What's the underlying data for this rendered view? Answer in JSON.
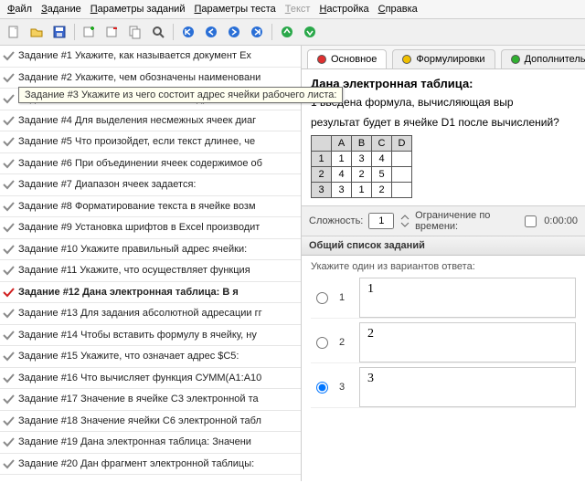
{
  "menu": [
    "Файл",
    "Задание",
    "Параметры заданий",
    "Параметры теста",
    "Текст",
    "Настройка",
    "Справка"
  ],
  "menu_disabled_index": 4,
  "tasks": [
    {
      "label": "Задание #1 Укажите, как называется документ Ex"
    },
    {
      "label": "Задание #2 Укажите, чем обозначены наименовани"
    },
    {
      "label": "Задание #3 Укажите из чего состоит адрес ячейк"
    },
    {
      "label": "Задание #4 Для выделения несмежных ячеек диаг"
    },
    {
      "label": "Задание #5 Что произойдет, если текст длинее, че"
    },
    {
      "label": "Задание #6 При объединении ячеек содержимое об"
    },
    {
      "label": "Задание #7 Диапазон ячеек задается:"
    },
    {
      "label": "Задание #8 Форматирование текста в ячейке возм"
    },
    {
      "label": "Задание #9 Установка шрифтов в Excel производит"
    },
    {
      "label": "Задание #10 Укажите правильный адрес ячейки:"
    },
    {
      "label": "Задание #11 Укажите, что осуществляет функция"
    },
    {
      "label": "Задание #12 Дана электронная таблица:  В я",
      "selected": true
    },
    {
      "label": "Задание #13 Для задания абсолютной адресации гг"
    },
    {
      "label": "Задание #14 Чтобы вставить формулу в ячейку, ну"
    },
    {
      "label": "Задание #15 Укажите, что означает адрес $C5:"
    },
    {
      "label": "Задание #16 Что вычисляет функция СУММ(A1:A10"
    },
    {
      "label": "Задание #17 Значение в ячейке C3 электронной та"
    },
    {
      "label": "Задание #18 Значение ячейки C6 электронной табл"
    },
    {
      "label": "Задание #19 Дана электронная таблица:  Значени"
    },
    {
      "label": "Задание #20 Дан фрагмент электронной таблицы:"
    }
  ],
  "tooltip": "Задание #3 Укажите из чего состоит адрес ячейки рабочего листа:",
  "tabs": [
    {
      "label": "Основное",
      "color": "red",
      "active": true
    },
    {
      "label": "Формулировки",
      "color": "yellow"
    },
    {
      "label": "Дополнительно",
      "color": "green"
    }
  ],
  "question": {
    "title": "Дана электронная таблица:",
    "text1": "1 введена формула, вычисляющая выр",
    "text2": "результат будет в ячейке D1 после вычислений?"
  },
  "sheet": {
    "cols": [
      "A",
      "B",
      "C",
      "D"
    ],
    "rows": [
      [
        "1",
        "1",
        "3",
        "4",
        ""
      ],
      [
        "2",
        "4",
        "2",
        "5",
        ""
      ],
      [
        "3",
        "3",
        "1",
        "2",
        ""
      ]
    ]
  },
  "difficulty": {
    "label": "Сложность:",
    "value": "1"
  },
  "timelimit": {
    "label": "Ограничение по времени:",
    "value": "0:00:00"
  },
  "section_list": "Общий список заданий",
  "answers_hint": "Укажите один из вариантов ответа:",
  "answers": [
    {
      "n": "1",
      "display": "1",
      "checked": false
    },
    {
      "n": "2",
      "display": "2",
      "checked": false
    },
    {
      "n": "3",
      "display": "3",
      "checked": true
    }
  ]
}
